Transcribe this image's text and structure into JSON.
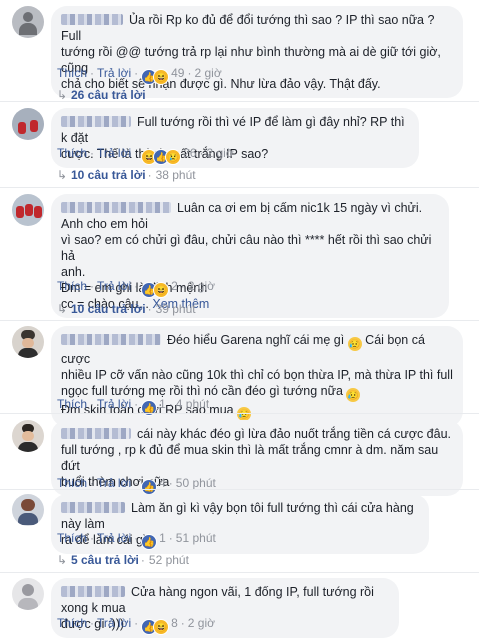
{
  "labels": {
    "like": "Thích",
    "reply": "Trả lời"
  },
  "icons": {
    "like": "like-icon",
    "haha": "haha-icon",
    "sad": "sad-icon",
    "reply_arrow": "reply-arrow-icon"
  },
  "colors": {
    "link": "#385898",
    "meta": "#90949c",
    "bubble": "#f2f3f5",
    "like": "#4267b2",
    "emoji": "#f7b928"
  },
  "comments": [
    {
      "text_lines": [
        "Ủa rồi Rp ko đủ để đổi tướng thì sao ? IP thì sao nữa ? Full",
        "tướng rồi @@ tướng trả rp lại như bình thường mà ai dè giữ tới giờ, cũng",
        "chả cho biết sẽ nhận được gì. Như lừa đảo vậy. Thật đấy."
      ],
      "reactions": "49",
      "time": "2 giờ",
      "replies": "26 câu trả lời"
    },
    {
      "text_lines": [
        "Full tướng rồi thì vé IP để làm gì đây nhỉ? RP thì k đặt",
        "cược. Thế là thành mất trắng IP sao?"
      ],
      "reactions": "26",
      "time": "2 giờ",
      "replies": "10 câu trả lời",
      "replies_time": "38 phút"
    },
    {
      "text_lines": [
        "Luân ca ơi em bị cấm nic1k 15 ngày vì chửi. Anh cho em hỏi",
        "vì sao? em có chửi gì đâu, chửi câu nào thì **** hết rồi thì sao chửi hả",
        "anh.",
        "Đm = em ghi là định mệnh",
        "cc = chào cậu... Xem thêm"
      ],
      "see_more": "Xem thêm",
      "reactions": "2",
      "time": "2 giờ",
      "replies": "10 câu trả lời",
      "replies_time": "39 phút"
    },
    {
      "text_lines": [
        "Đéo hiểu Garena nghĩ cái mẹ gì",
        "Cái bọn cá cược",
        "nhiều IP cỡ vấn nào cũng 10k thì chỉ có bọn thừa IP, mà thừa IP thì full",
        "ngọc full tướng mẹ rồi thì nó cần đéo gì tướng nữa",
        "Đm skin toàn chơi RP sao mua"
      ],
      "reactions": "1",
      "time": "4 phút"
    },
    {
      "text_lines": [
        "cái này khác đéo gì lừa đảo nuốt trắng tiền cá cược đâu.",
        "full tướng , rp k đủ để mua skin thì là mất trắng cmnr à dm. năm sau đứt",
        "buổi thèm chơi nữa"
      ],
      "reactions": "4",
      "time": "50 phút"
    },
    {
      "text_lines": [
        "Làm ăn gì kì vậy bọn tôi full tướng thì cái cửa hàng này làm",
        "ra để làm cái gì"
      ],
      "reactions": "1",
      "time": "51 phút",
      "replies": "5 câu trả lời",
      "replies_time": "52 phút"
    },
    {
      "text_lines": [
        "Cửa hàng ngon vãi, 1 đống IP, full tướng rồi xong k mua",
        "được gì :)))"
      ],
      "reactions": "8",
      "time": "2 giờ"
    }
  ]
}
